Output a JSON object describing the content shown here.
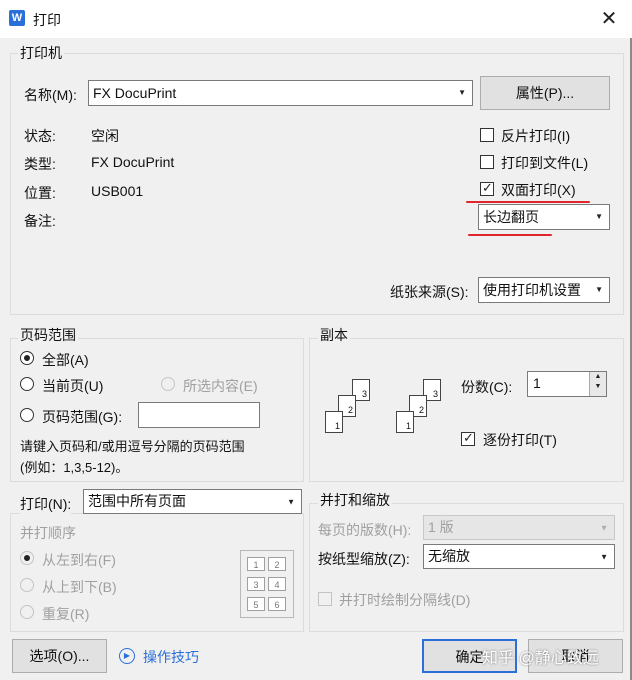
{
  "window": {
    "title": "打印",
    "app_icon": "W"
  },
  "printer": {
    "group_title": "打印机",
    "name_label": "名称(M):",
    "name_value": "FX DocuPrint",
    "properties_button": "属性(P)...",
    "status_label": "状态:",
    "status_value": "空闲",
    "type_label": "类型:",
    "type_value": "FX DocuPrint",
    "location_label": "位置:",
    "location_value": "USB001",
    "comment_label": "备注:",
    "reverse_print": {
      "label": "反片打印(I)",
      "checked": false
    },
    "print_to_file": {
      "label": "打印到文件(L)",
      "checked": false
    },
    "duplex": {
      "label": "双面打印(X)",
      "checked": true
    },
    "duplex_mode": "长边翻页",
    "paper_source_label": "纸张来源(S):",
    "paper_source_value": "使用打印机设置"
  },
  "page_range": {
    "group_title": "页码范围",
    "all": "全部(A)",
    "current": "当前页(U)",
    "selection": "所选内容(E)",
    "pages": "页码范围(G):",
    "hint_line1": "请键入页码和/或用逗号分隔的页码范围",
    "hint_line2": "(例如：1,3,5-12)。"
  },
  "copies": {
    "group_title": "副本",
    "count_label": "份数(C):",
    "count_value": "1",
    "collate_label": "逐份打印(T)",
    "collate_checked": true
  },
  "print_what": {
    "label": "打印(N):",
    "value": "范围中所有页面",
    "order_title": "并打顺序",
    "left_to_right": "从左到右(F)",
    "top_to_bottom": "从上到下(B)",
    "repeat": "重复(R)"
  },
  "zoom": {
    "group_title": "并打和缩放",
    "pages_per_sheet_label": "每页的版数(H):",
    "pages_per_sheet_value": "1 版",
    "scale_label": "按纸型缩放(Z):",
    "scale_value": "无缩放",
    "draw_separator": "并打时绘制分隔线(D)"
  },
  "footer": {
    "options_button": "选项(O)...",
    "tips_link": "操作技巧",
    "ok_button": "确定",
    "cancel_button": "取消"
  },
  "watermark": "知乎 @静心致远",
  "colors": {
    "accent": "#2b6fd8",
    "annotation_red": "#e0262c"
  }
}
